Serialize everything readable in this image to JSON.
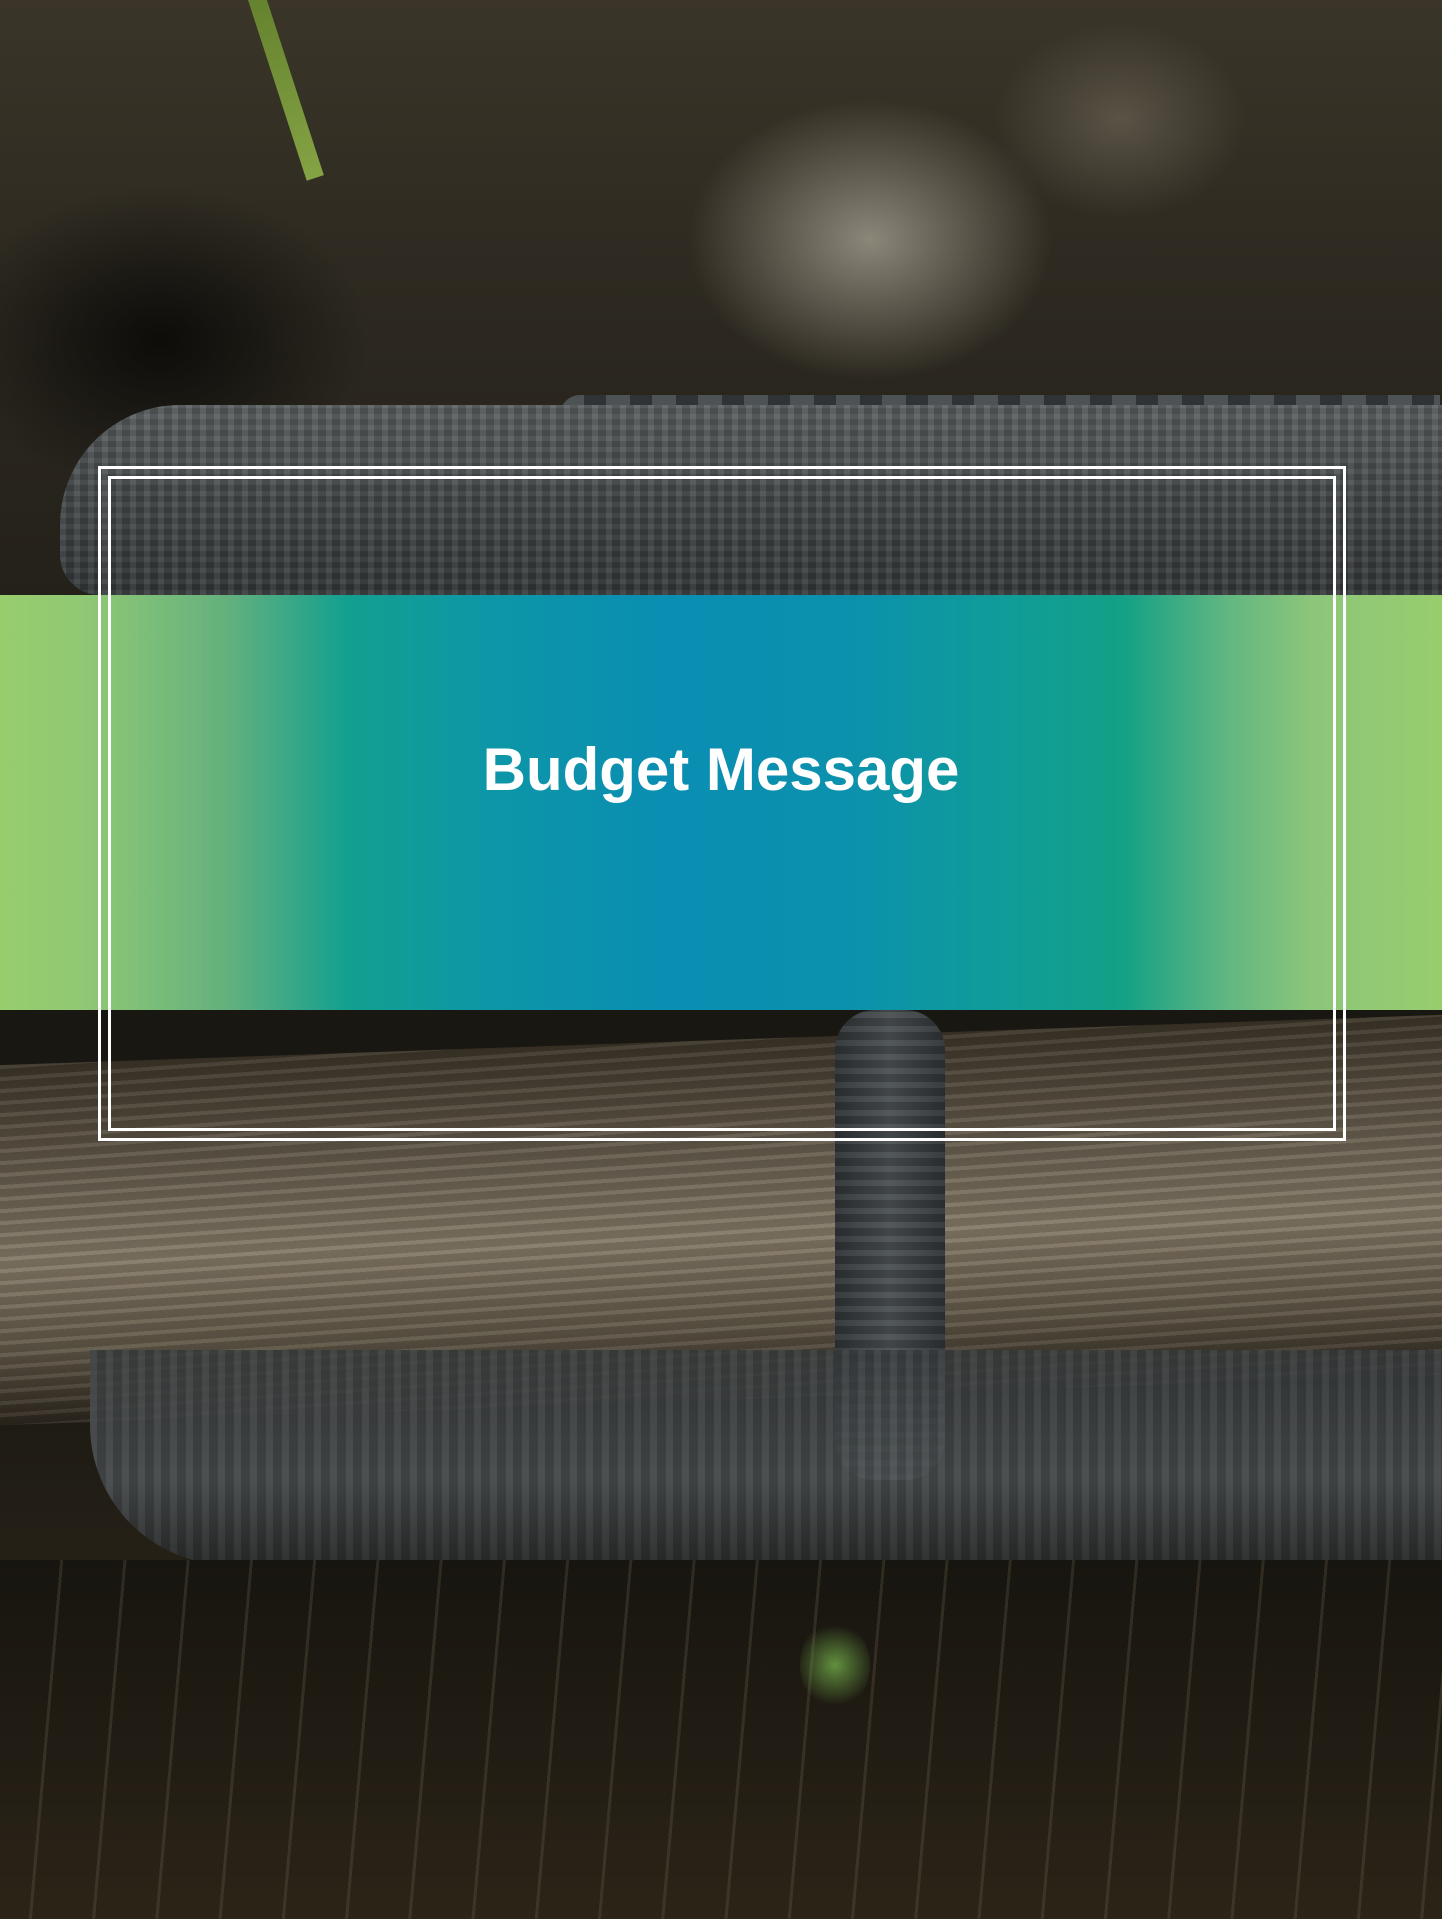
{
  "document": {
    "title": "Budget Message"
  },
  "colors": {
    "band_edge": "#98cd6e",
    "band_teal": "#13a08f",
    "band_center": "#0a8eb2",
    "title_text": "#ffffff",
    "frame_rule": "#ffffff"
  },
  "background_photo": {
    "subject": "alligator-on-log-with-reflection"
  }
}
